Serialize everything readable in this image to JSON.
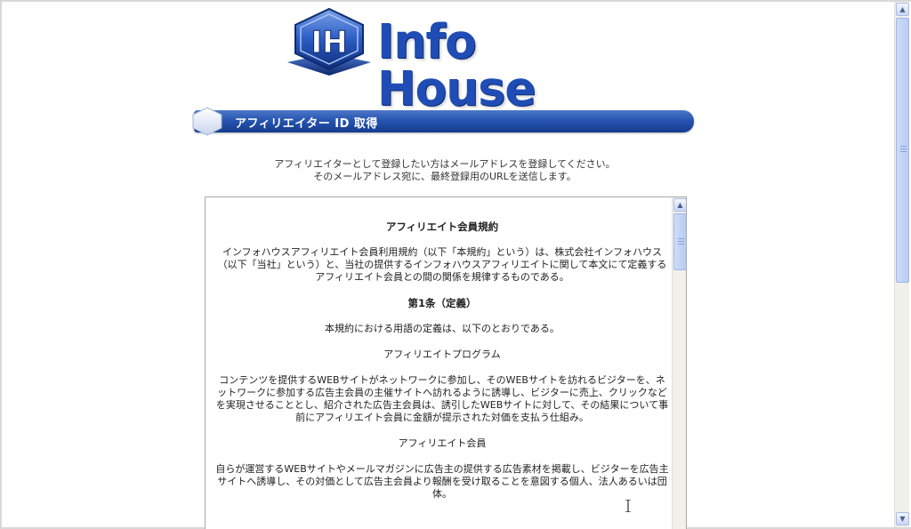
{
  "brand": {
    "logo_mark": "IH",
    "logo_text": "Info House"
  },
  "banner": {
    "title": "アフィリエイター ID 取得",
    "icon": "hexagon-icon"
  },
  "intro": {
    "line1": "アフィリエイターとして登録したい方はメールアドレスを登録してください。",
    "line2": "そのメールアドレス宛に、最終登録用のURLを送信します。"
  },
  "terms": {
    "heading": "アフィリエイト会員規約",
    "preamble": "インフォハウスアフィリエイト会員利用規約（以下「本規約」という）は、株式会社インフォハウス（以下「当社」という）と、当社の提供するインフォハウスアフィリエイトに関して本文にて定義するアフィリエイト会員との間の関係を規律するものである。",
    "article1_title": "第1条（定義）",
    "article1_intro": "本規約における用語の定義は、以下のとおりである。",
    "term1_name": "アフィリエイトプログラム",
    "term1_def": "コンテンツを提供するWEBサイトがネットワークに参加し、そのWEBサイトを訪れるビジターを、ネットワークに参加する広告主会員の主催サイトへ訪れるように誘導し、ビジターに売上、クリックなどを実現させることとし、紹介された広告主会員は、誘引したWEBサイトに対して、その結果について事前にアフィリエイト会員に金額が提示された対価を支払う仕組み。",
    "term2_name": "アフィリエイト会員",
    "term2_def": "自らが運営するWEBサイトやメールマガジンに広告主の提供する広告素材を掲載し、ビジターを広告主サイトへ誘導し、その対価として広告主会員より報酬を受け取ることを意図する個人、法人あるいは団体。"
  },
  "colors": {
    "brand_blue": "#1f4db5",
    "banner_dark": "#153c8e",
    "scroll_track": "#f1f0ea"
  }
}
